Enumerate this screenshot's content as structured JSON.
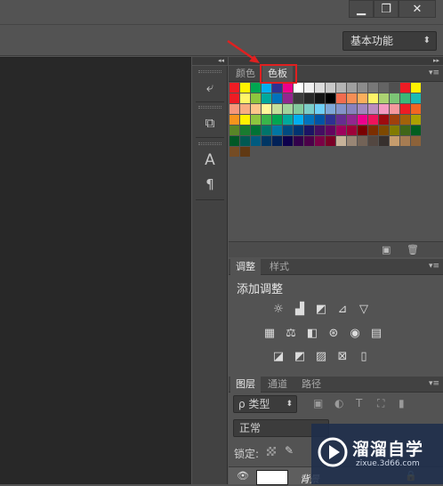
{
  "window_controls": {
    "minimize": "▁",
    "maximize": "❐",
    "close": "✕"
  },
  "optbar": {
    "workspace_label": "基本功能",
    "workspace_arrow": "⬍"
  },
  "collapse_glyph": "◂◂",
  "collapse_glyph_right": "▸▸",
  "dock": {
    "icons": [
      {
        "name": "history-icon",
        "glyph": "⤶"
      },
      {
        "name": "3d-cube-icon",
        "glyph": "⧉"
      },
      {
        "name": "character-icon",
        "glyph": "A"
      },
      {
        "name": "paragraph-icon",
        "glyph": "¶"
      }
    ]
  },
  "color_panel": {
    "tabs": [
      "颜色",
      "色板"
    ],
    "active_tab": "色板",
    "menu_glyph": "▾≡"
  },
  "swatches": {
    "rows": [
      [
        "#ee1c24",
        "#fff200",
        "#00a651",
        "#00aeef",
        "#2e3192",
        "#ec008c",
        "#ffffff",
        "#f0f0f0",
        "#dcdcdc",
        "#c8c8c8",
        "#b4b4b4",
        "#a0a0a0",
        "#8c8c8c",
        "#787878",
        "#646464",
        "#505050",
        "#ee1c24",
        "#fff200"
      ],
      [
        "#ed1c24",
        "#fff568",
        "#8dc63f",
        "#00a99d",
        "#0072bc",
        "#92278f",
        "#3c3c3c",
        "#282828",
        "#141414",
        "#000000",
        "#f26c4f",
        "#f68e55",
        "#fbaf5c",
        "#fff467",
        "#acd372",
        "#7cc576",
        "#3bb878",
        "#1abbb4"
      ],
      [
        "#f7977a",
        "#f9ad81",
        "#fdc68a",
        "#fff79a",
        "#c4df9b",
        "#a2d39c",
        "#82ca9d",
        "#7bcdc8",
        "#6ecff6",
        "#7ea7d8",
        "#8493ca",
        "#8882be",
        "#a187be",
        "#bc8dbf",
        "#f49ac2",
        "#f6989d",
        "#ed1c24",
        "#f26522"
      ],
      [
        "#f7941d",
        "#fff200",
        "#8dc63f",
        "#39b54a",
        "#00a651",
        "#00a99d",
        "#00aeef",
        "#0072bc",
        "#0054a6",
        "#2e3192",
        "#662d91",
        "#92278f",
        "#ec008c",
        "#ed145b",
        "#9e0b0f",
        "#a0410d",
        "#a3620a",
        "#aba000"
      ],
      [
        "#598527",
        "#197b30",
        "#007236",
        "#00746b",
        "#0076a3",
        "#004a80",
        "#003471",
        "#1b1464",
        "#440e62",
        "#630460",
        "#9e005d",
        "#9e0039",
        "#790000",
        "#7b2e00",
        "#7d4900",
        "#827b00",
        "#406618",
        "#005e20"
      ],
      [
        "#005826",
        "#005952",
        "#005b7f",
        "#003663",
        "#002157",
        "#0d004c",
        "#32004b",
        "#4b0049",
        "#7b0046",
        "#7a0026",
        "#c7b299",
        "#998675",
        "#736357",
        "#534741",
        "#37302d",
        "#c69c6d",
        "#a67c52",
        "#8c6239"
      ],
      [
        "#754c24",
        "#603913"
      ]
    ]
  },
  "adjust_panel": {
    "tabs": [
      "调整",
      "样式"
    ],
    "active_tab": "调整",
    "heading": "添加调整",
    "icons": [
      [
        "brightness-icon",
        "levels-icon",
        "curves-icon",
        "exposure-icon",
        "vibrance-icon"
      ],
      [
        "hue-saturation-icon",
        "color-balance-icon",
        "black-white-icon",
        "photo-filter-icon",
        "channel-mixer-icon",
        "color-lookup-icon"
      ],
      [
        "invert-icon",
        "posterize-icon",
        "threshold-icon",
        "selective-color-icon",
        "gradient-map-icon"
      ]
    ],
    "glyphs": [
      [
        "☼",
        "▟",
        "◩",
        "⊿",
        "▽"
      ],
      [
        "▦",
        "⚖",
        "◧",
        "⊛",
        "◉",
        "▤"
      ],
      [
        "◪",
        "◩",
        "▨",
        "⊠",
        "▯"
      ]
    ]
  },
  "layers_panel": {
    "tabs": [
      "图层",
      "通道",
      "路径"
    ],
    "active_tab": "图层",
    "filter_label": "ρ 类型",
    "filter_arrow": "⬍",
    "blend_mode": "正常",
    "lock_label": "锁定:",
    "layer_name": "背景",
    "filter_icons": [
      "▣",
      "◐",
      "T",
      "⛶",
      "▮"
    ]
  },
  "watermark": {
    "brand": "溜溜自学",
    "url": "zixue.3d66.com"
  },
  "annotation": {
    "color": "#e02020"
  }
}
